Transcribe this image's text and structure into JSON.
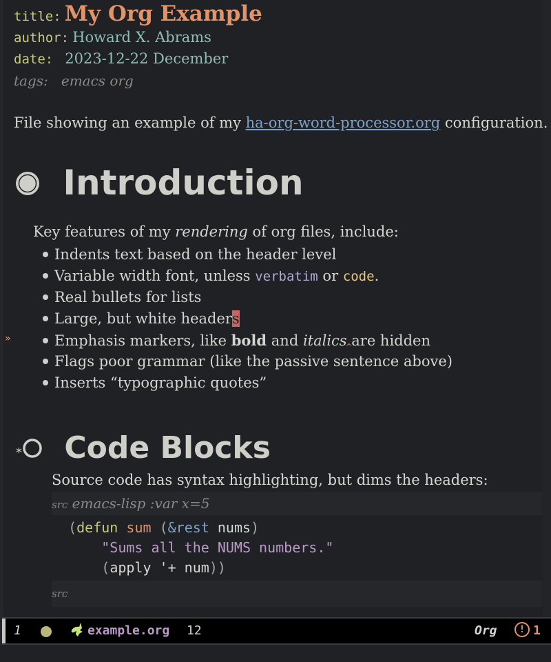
{
  "meta": {
    "title_label": "title:",
    "title_value": "My Org Example",
    "author_label": "author:",
    "author_value": "Howard X. Abrams",
    "date_label": "date:",
    "date_value": "2023-12-22 December",
    "tags_label": "tags:",
    "tags_value": "emacs org"
  },
  "intro_paragraph": {
    "before": "File showing an example of my ",
    "link": "ha-org-word-processor.org",
    "after": " configuration."
  },
  "section1": {
    "heading": "Introduction",
    "bullet_icon": "filled-circle",
    "intro": {
      "before": "Key features of my ",
      "italic": "rendering",
      "after": " of org files, include:"
    },
    "items": [
      {
        "text": "Indents text based on the header level"
      },
      {
        "before": "Variable width font, unless ",
        "verbatim": "verbatim",
        "middle": " or ",
        "code": "code",
        "after": "."
      },
      {
        "text": "Real bullets for lists"
      },
      {
        "before": "Large, but white header",
        "cursor_char": "s"
      },
      {
        "before": "Emphasis markers, like ",
        "bold": "bold",
        "middle": " and ",
        "italic": "italics",
        "after": " are hidden"
      },
      {
        "text": "Flags poor grammar (like the passive sentence above)"
      },
      {
        "text": "Inserts “typographic quotes”"
      }
    ],
    "fringe_marker": "»"
  },
  "section2": {
    "heading": "Code Blocks",
    "bullet_icon": "hollow-circle",
    "fringe_marker": "*",
    "paragraph": "Source code has syntax highlighting, but dims the headers:",
    "src_header": {
      "keyword": "src",
      "args": "emacs-lisp :var x=5"
    },
    "code_lines": [
      [
        {
          "t": "(",
          "c": "paren"
        },
        {
          "t": "defun",
          "c": "defun"
        },
        {
          "t": " "
        },
        {
          "t": "sum",
          "c": "fn"
        },
        {
          "t": " "
        },
        {
          "t": "(",
          "c": "paren"
        },
        {
          "t": "&rest",
          "c": "rest"
        },
        {
          "t": " nums"
        },
        {
          "t": ")",
          "c": "paren"
        }
      ],
      [
        {
          "t": "  "
        },
        {
          "t": "\"Sums all the NUMS numbers.\"",
          "c": "str"
        }
      ],
      [
        {
          "t": "  "
        },
        {
          "t": "(",
          "c": "paren"
        },
        {
          "t": "apply '+ num"
        },
        {
          "t": "))",
          "c": "paren"
        }
      ]
    ],
    "src_footer": "src"
  },
  "modeline": {
    "window_number": "1",
    "status_dot_color": "#b8b87a",
    "mode_icon": "unicorn-icon",
    "filename": "example.org",
    "line_number": "12",
    "major_mode": "Org",
    "warning_count": "1",
    "warning_icon": "!"
  },
  "colors": {
    "background": "#202124",
    "title": "#e2936a",
    "keyword": "#c7c97d",
    "meta_value": "#8fbcb6",
    "link": "#7ea1c7",
    "verbatim": "#b0a8d8",
    "code": "#e8c77f",
    "string": "#b99ac7",
    "cursor": "#c86464"
  }
}
